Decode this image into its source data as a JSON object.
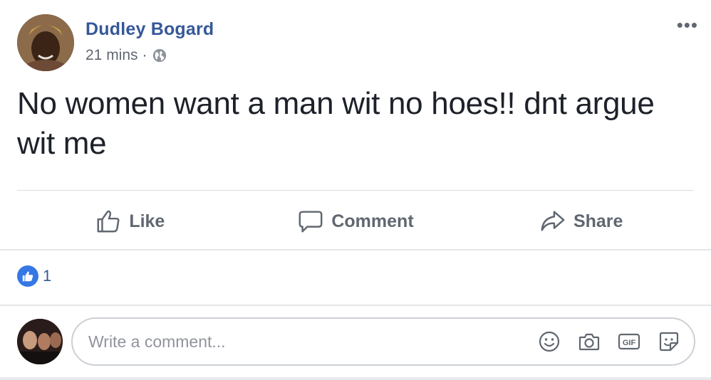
{
  "post": {
    "author": "Dudley Bogard",
    "time": "21 mins",
    "separator": "·",
    "text": "No women want a man wit no hoes!! dnt argue wit me",
    "more_label": "•••"
  },
  "actions": {
    "like": "Like",
    "comment": "Comment",
    "share": "Share"
  },
  "reactions": {
    "count": "1"
  },
  "composer": {
    "placeholder": "Write a comment...",
    "gif_label": "GIF"
  },
  "colors": {
    "author": "#365899",
    "like_badge": "#3578e5",
    "muted": "#606770"
  },
  "icons": [
    "globe-icon",
    "more-icon",
    "like-icon",
    "comment-icon",
    "share-icon",
    "emoji-icon",
    "camera-icon",
    "gif-icon",
    "sticker-icon"
  ]
}
